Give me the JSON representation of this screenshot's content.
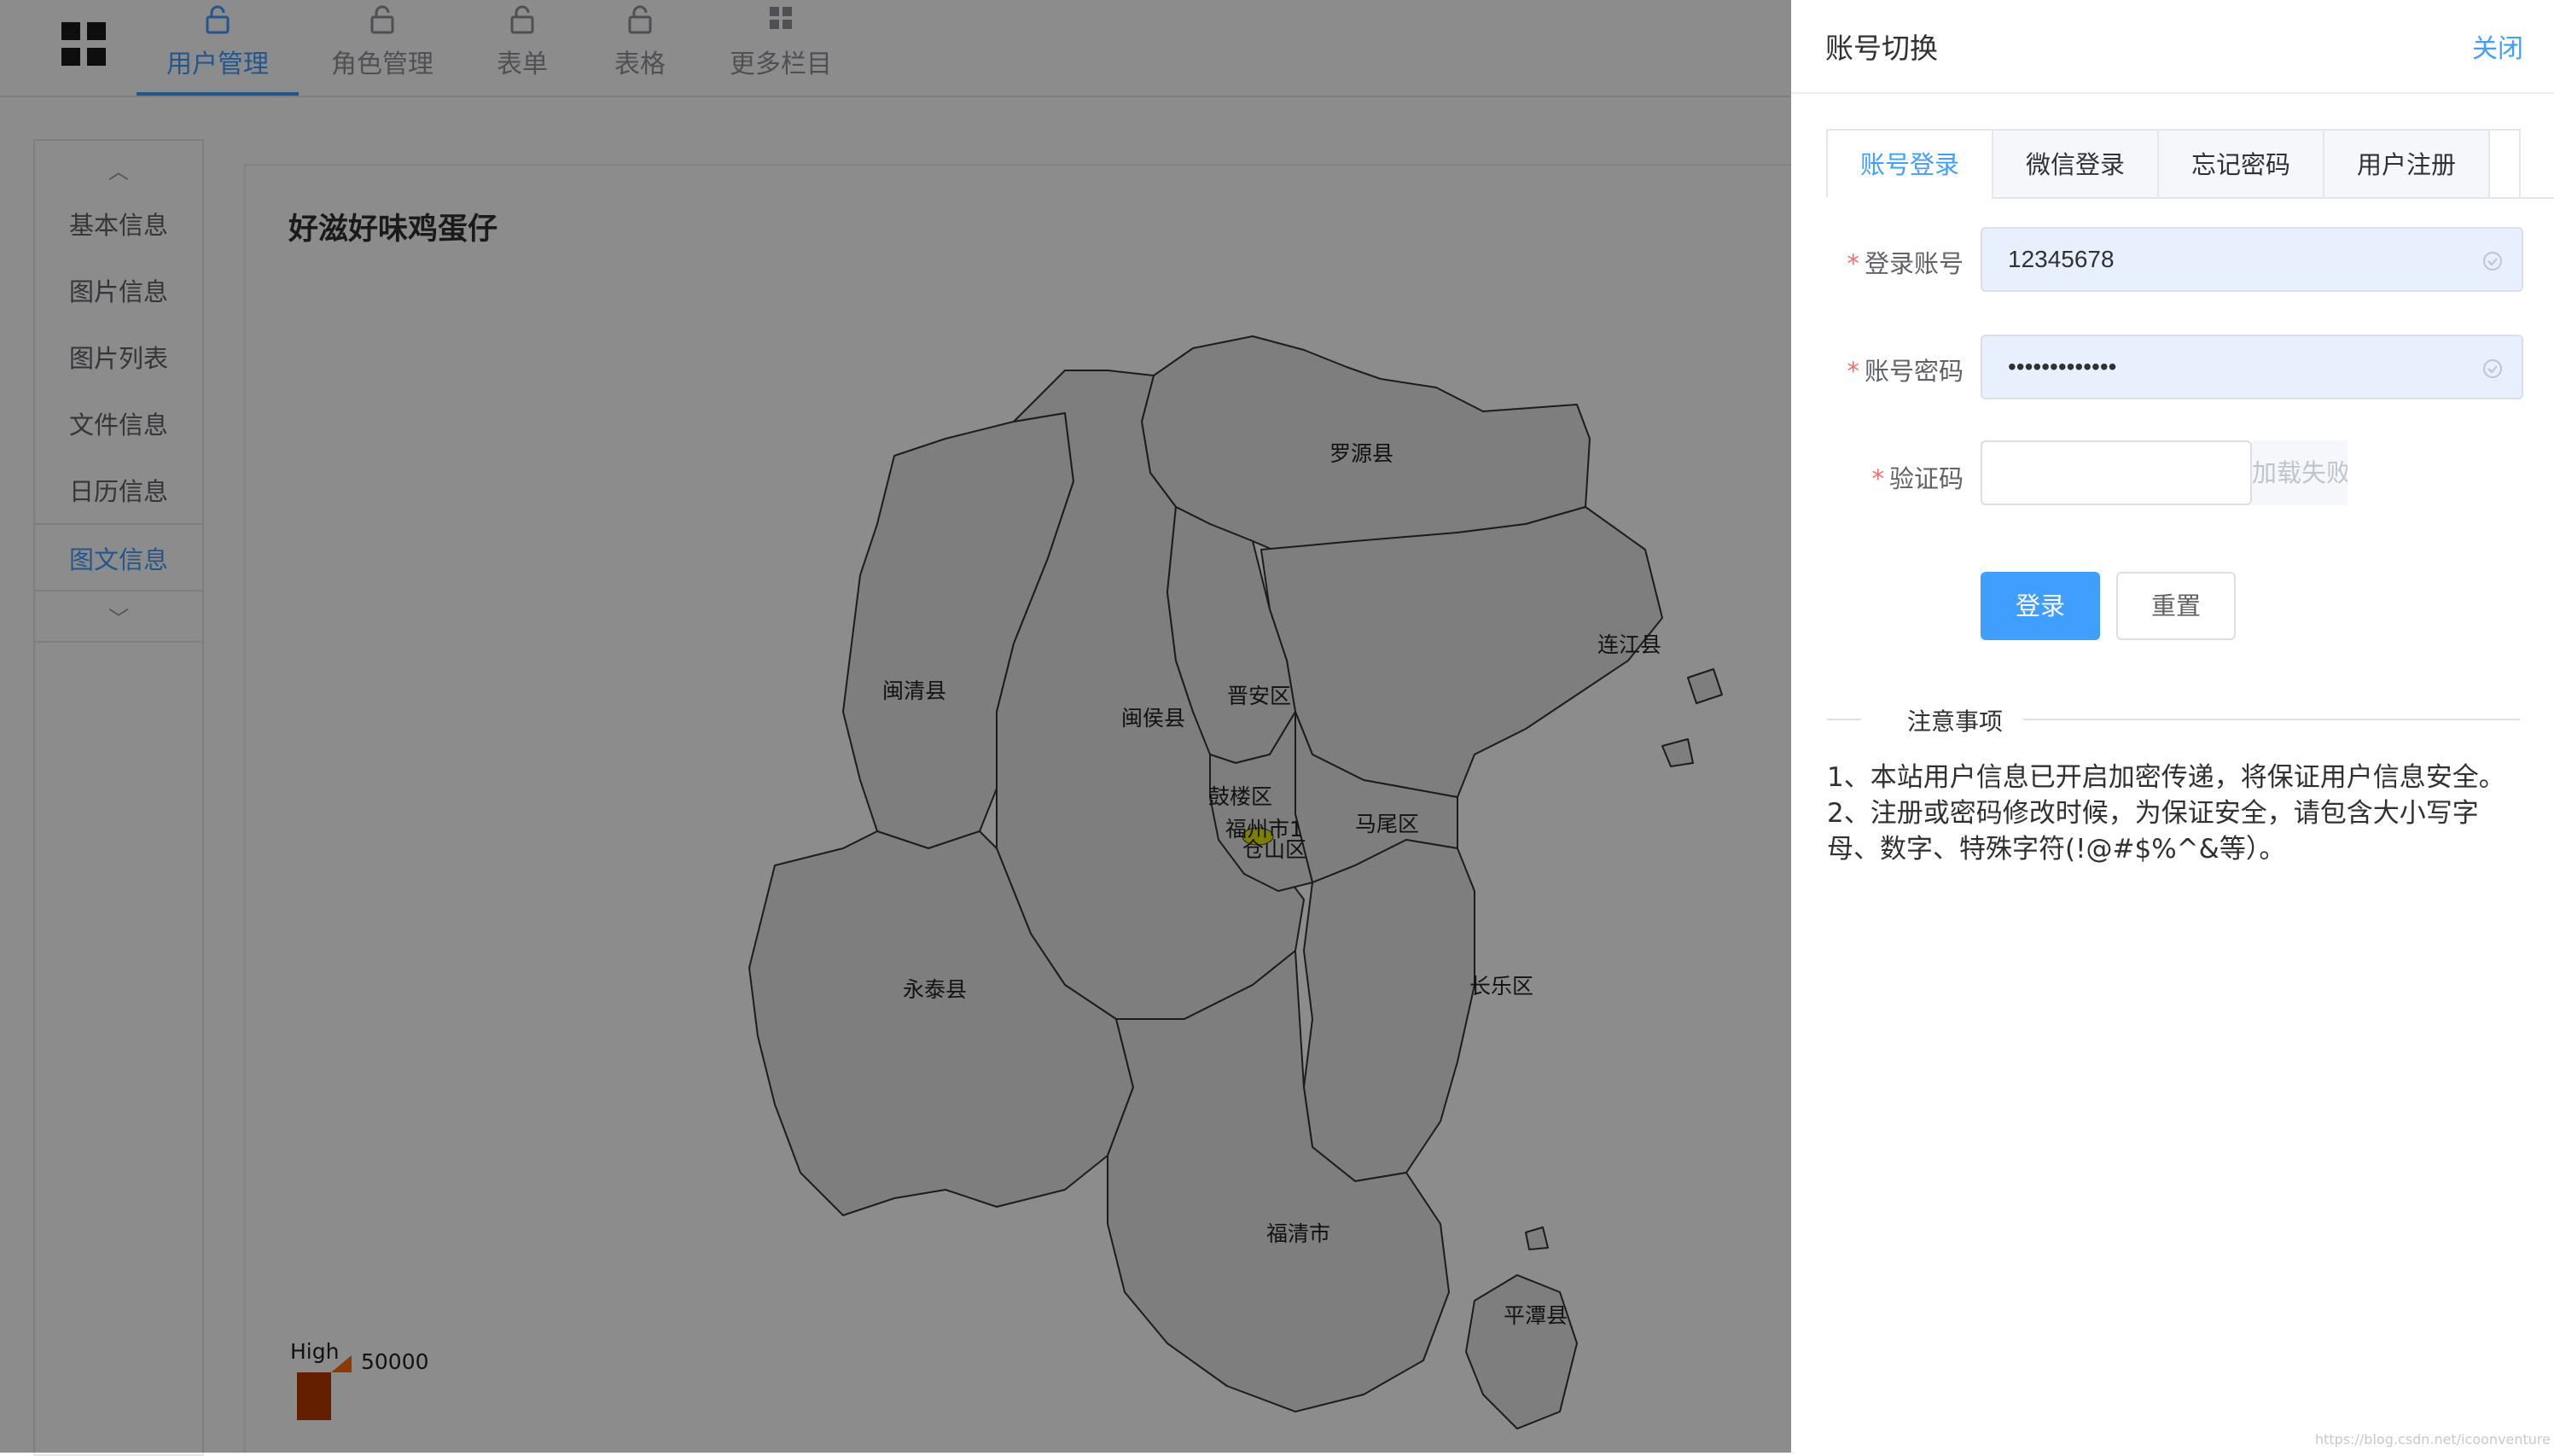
{
  "nav": {
    "tabs": [
      {
        "label": "用户管理",
        "icon": "lock-open-icon",
        "active": true
      },
      {
        "label": "角色管理",
        "icon": "lock-open-icon"
      },
      {
        "label": "表单",
        "icon": "lock-open-icon"
      },
      {
        "label": "表格",
        "icon": "lock-open-icon"
      },
      {
        "label": "更多栏目",
        "icon": "grid-icon"
      }
    ]
  },
  "sidebar": {
    "items": [
      {
        "label": "基本信息"
      },
      {
        "label": "图片信息"
      },
      {
        "label": "图片列表"
      },
      {
        "label": "文件信息"
      },
      {
        "label": "日历信息"
      },
      {
        "label": "图文信息",
        "active": true
      }
    ]
  },
  "card": {
    "title": "好滋好味鸡蛋仔"
  },
  "map": {
    "regions": [
      {
        "name": "罗源县"
      },
      {
        "name": "连江县"
      },
      {
        "name": "闽清县"
      },
      {
        "name": "闽侯县"
      },
      {
        "name": "晋安区"
      },
      {
        "name": "鼓楼区"
      },
      {
        "name": "福州市1",
        "highlighted": true,
        "value_color": "#e6e600"
      },
      {
        "name": "仓山区"
      },
      {
        "name": "马尾区"
      },
      {
        "name": "永泰县"
      },
      {
        "name": "长乐区"
      },
      {
        "name": "福清市"
      },
      {
        "name": "平潭县"
      }
    ],
    "visual_map": {
      "label": "High",
      "max": "50000",
      "colors": [
        "#b73a00",
        "#ff6a00"
      ]
    }
  },
  "drawer": {
    "title": "账号切换",
    "close_label": "关闭",
    "tabs": [
      {
        "label": "账号登录",
        "active": true
      },
      {
        "label": "微信登录"
      },
      {
        "label": "忘记密码"
      },
      {
        "label": "用户注册"
      }
    ],
    "form": {
      "account_label": "登录账号",
      "account_value": "12345678",
      "password_label": "账号密码",
      "password_value": "•••••••••••••",
      "captcha_label": "验证码",
      "captcha_value": "",
      "captcha_fail": "加载失败",
      "required_mark": "*"
    },
    "buttons": {
      "login": "登录",
      "reset": "重置"
    },
    "notes_title": "注意事项",
    "notes": [
      "1、本站用户信息已开启加密传递，将保证用户信息安全。",
      "2、注册或密码修改时候，为保证安全，请包含大小写字母、数字、特殊字符(!@#$%^&等）。"
    ]
  },
  "colors": {
    "accent": "#409eff",
    "required": "#f56c6c",
    "mask": "rgba(0,0,0,0.45)"
  },
  "watermark": "https://blog.csdn.net/icoonventure"
}
